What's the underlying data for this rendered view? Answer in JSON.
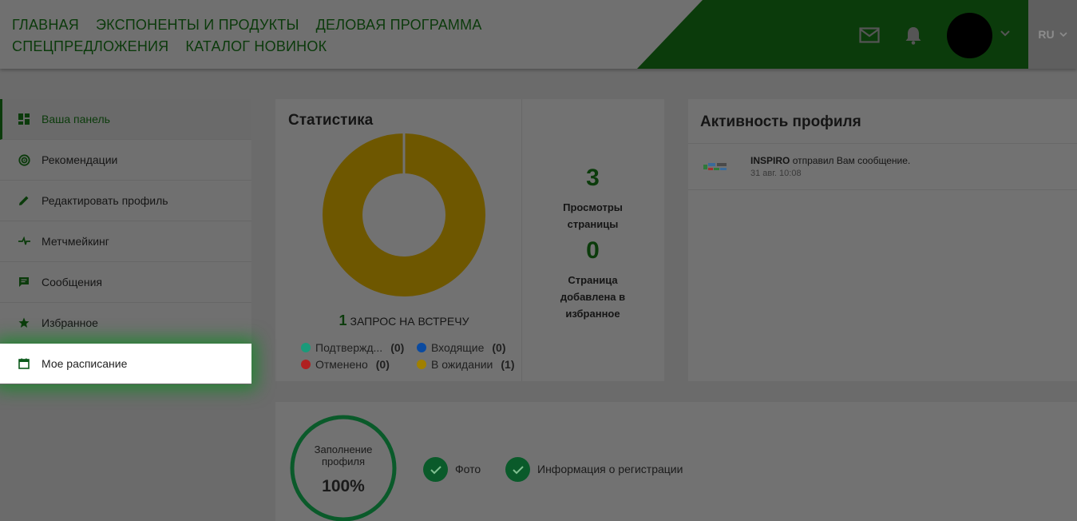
{
  "nav": {
    "row1": [
      "ГЛАВНАЯ",
      "ЭКСПОНЕНТЫ И ПРОДУКТЫ",
      "ДЕЛОВАЯ ПРОГРАММА"
    ],
    "row2": [
      "СПЕЦПРЕДЛОЖЕНИЯ",
      "КАТАЛОГ НОВИНОК"
    ]
  },
  "header": {
    "language": "RU",
    "icons": [
      "mail-icon",
      "bell-icon",
      "chevron-down-icon"
    ]
  },
  "sidebar": {
    "items": [
      {
        "label": "Ваша панель",
        "icon": "dashboard-icon"
      },
      {
        "label": "Рекомендации",
        "icon": "radar-icon"
      },
      {
        "label": "Редактировать профиль",
        "icon": "pencil-icon"
      },
      {
        "label": "Метчмейкинг",
        "icon": "matchmaking-icon"
      },
      {
        "label": "Сообщения",
        "icon": "message-icon"
      },
      {
        "label": "Избранное",
        "icon": "star-icon"
      },
      {
        "label": "Мое расписание",
        "icon": "calendar-icon"
      }
    ]
  },
  "stats": {
    "title": "Статистика",
    "meetings_count": "1",
    "meetings_label": "ЗАПРОС НА ВСТРЕЧУ",
    "legend": [
      {
        "label": "Подтвержд...",
        "count": "(0)",
        "color": "#1a9a7a"
      },
      {
        "label": "Входящие",
        "count": "(0)",
        "color": "#0a4aa0"
      },
      {
        "label": "Отменено",
        "count": "(0)",
        "color": "#b02020"
      },
      {
        "label": "В ожидании",
        "count": "(1)",
        "color": "#a08000"
      }
    ],
    "views_count": "3",
    "views_label_1": "Просмотры",
    "views_label_2": "страницы",
    "fav_count": "0",
    "fav_label_1": "Страница",
    "fav_label_2": "добавлена в",
    "fav_label_3": "избранное"
  },
  "activity": {
    "title": "Активность профиля",
    "items": [
      {
        "sender": "INSPIRO",
        "text": "отправил Вам сообщение.",
        "time": "31 авг. 10:08"
      }
    ]
  },
  "profile": {
    "label_1": "Заполнение",
    "label_2": "профиля",
    "percent": "100%",
    "percent_value": 100,
    "checks": [
      "Фото",
      "Информация о регистрации"
    ]
  },
  "colors": {
    "brand": "#0b3b0b",
    "donut_pending": "#6e5700",
    "check": "#0a5a2a"
  }
}
